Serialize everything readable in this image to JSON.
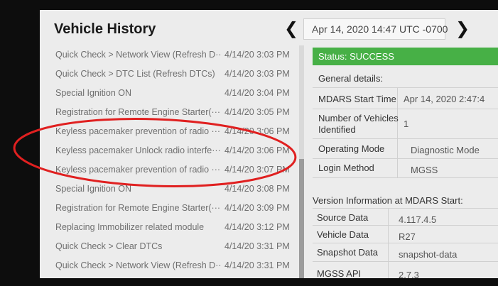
{
  "header": {
    "title": "Vehicle History",
    "prev_glyph": "❮",
    "date": "Apr 14, 2020 14:47 UTC -0700",
    "next_glyph": "❯"
  },
  "history": [
    {
      "description": "Quick Check > Network View (Refresh D···",
      "time": "4/14/20 3:03 PM"
    },
    {
      "description": "Quick Check > DTC List (Refresh DTCs)",
      "time": "4/14/20 3:03 PM"
    },
    {
      "description": "Special Ignition ON",
      "time": "4/14/20 3:04 PM"
    },
    {
      "description": "Registration for Remote Engine Starter(···",
      "time": "4/14/20 3:05 PM"
    },
    {
      "description": "Keyless pacemaker prevention of radio ···",
      "time": "4/14/20 3:06 PM"
    },
    {
      "description": "Keyless pacemaker Unlock radio interfe···",
      "time": "4/14/20 3:06 PM"
    },
    {
      "description": "Keyless pacemaker prevention of radio ···",
      "time": "4/14/20 3:07 PM"
    },
    {
      "description": "Special Ignition ON",
      "time": "4/14/20 3:08 PM"
    },
    {
      "description": "Registration for Remote Engine Starter(···",
      "time": "4/14/20 3:09 PM"
    },
    {
      "description": "Replacing Immobilizer related module",
      "time": "4/14/20 3:12 PM"
    },
    {
      "description": "Quick Check > Clear DTCs",
      "time": "4/14/20 3:31 PM"
    },
    {
      "description": "Quick Check > Network View (Refresh D···",
      "time": "4/14/20 3:31 PM"
    }
  ],
  "details": {
    "status": "Status: SUCCESS",
    "general_heading": "General details:",
    "mdars_start_time_label": "MDARS Start Time",
    "mdars_start_time_value": "Apr 14, 2020 2:47:4",
    "vehicles_label_1": "Number of Vehicles",
    "vehicles_label_2": "Identified",
    "vehicles_value": "1",
    "operating_mode_label": "Operating Mode",
    "operating_mode_value": "Diagnostic Mode",
    "login_method_label": "Login Method",
    "login_method_value": "MGSS",
    "version_heading": "Version Information at MDARS Start:",
    "source_data_label": "Source Data",
    "source_data_value": "4.117.4.5",
    "vehicle_data_label": "Vehicle Data",
    "vehicle_data_value": "R27",
    "snapshot_data_label": "Snapshot Data",
    "snapshot_data_value": "snapshot-data",
    "mgss_api_label": "MGSS API",
    "mgss_api_value": "2.7.3"
  },
  "colors": {
    "status_green": "#47b046",
    "annotation_red": "#e02020"
  }
}
